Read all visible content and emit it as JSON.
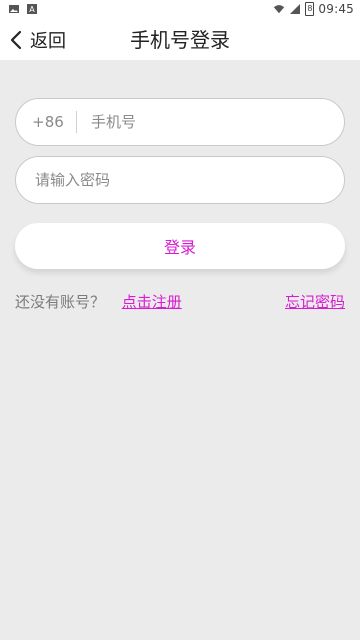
{
  "status_bar": {
    "time": "09:45",
    "battery_text": "8"
  },
  "header": {
    "back_label": "返回",
    "title": "手机号登录"
  },
  "form": {
    "phone_prefix": "+86",
    "phone_placeholder": "手机号",
    "password_placeholder": "请输入密码",
    "login_button": "登录"
  },
  "footer": {
    "no_account_text": "还没有账号？",
    "register_link": "点击注册",
    "forgot_link": "忘记密码"
  },
  "colors": {
    "accent": "#d91bd3",
    "background": "#ebebeb"
  },
  "icons": {
    "back": "back-icon",
    "image": "image-icon",
    "a": "a-icon",
    "wifi": "wifi-icon",
    "signal": "signal-icon",
    "battery": "battery-icon"
  }
}
